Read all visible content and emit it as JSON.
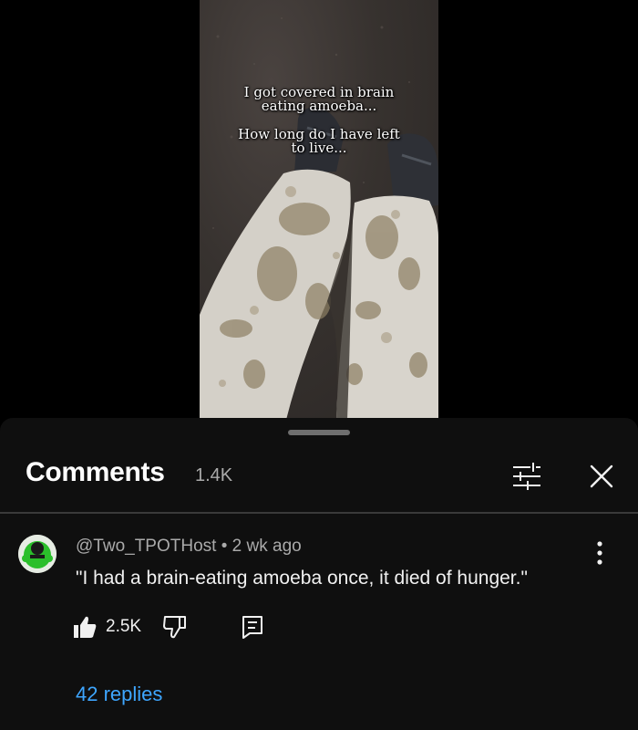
{
  "video": {
    "caption_line1a": "I got covered in brain",
    "caption_line1b": "eating amoeba...",
    "caption_line2a": "How long do I have left",
    "caption_line2b": "to live..."
  },
  "comments_panel": {
    "title": "Comments",
    "count": "1.4K",
    "filter_icon": "sliders-icon",
    "close_icon": "close-icon"
  },
  "comment": {
    "author": "@Two_TPOTHost",
    "separator": "•",
    "time": "2 wk ago",
    "text": "\"I had a brain-eating amoeba once, it died of hunger.\"",
    "likes": "2.5K",
    "replies_label": "42 replies",
    "avatar_color": "#2bbf2b",
    "link_color": "#3ea6ff"
  }
}
